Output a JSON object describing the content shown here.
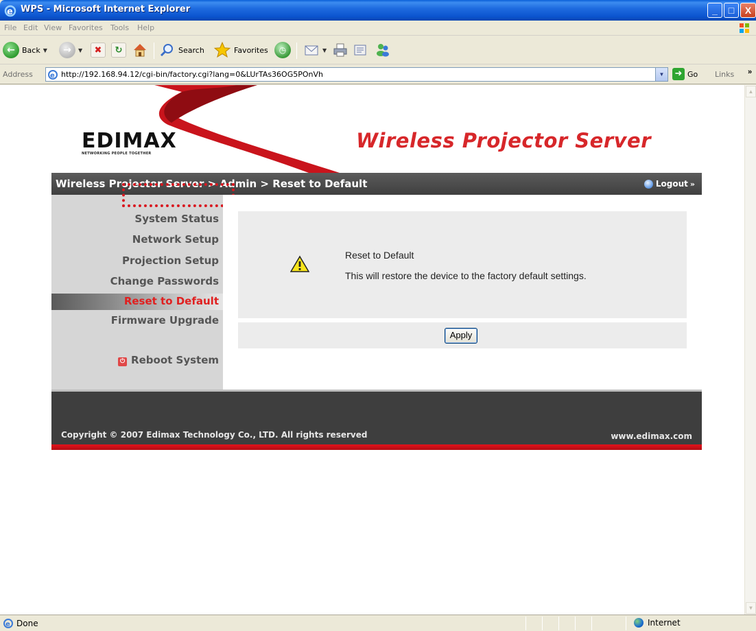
{
  "window": {
    "title": "WPS - Microsoft Internet Explorer",
    "controls": {
      "minimize": "_",
      "maximize": "□",
      "close": "X"
    }
  },
  "menu": [
    "File",
    "Edit",
    "View",
    "Favorites",
    "Tools",
    "Help"
  ],
  "toolbar": {
    "back": "Back",
    "search": "Search",
    "favorites": "Favorites"
  },
  "address": {
    "label": "Address",
    "url": "http://192.168.94.12/cgi-bin/factory.cgi?lang=0&LUrTAs36OG5POnVh",
    "go": "Go",
    "links": "Links",
    "links_more": "»"
  },
  "page": {
    "logo": "EDIMAX",
    "logo_tagline": "NETWORKING PEOPLE TOGETHER",
    "product_title": "Wireless Projector Server",
    "breadcrumb": "Wireless Projector Server > Admin > Reset to Default",
    "logout": "Logout",
    "logout_suffix": "»",
    "nav": [
      {
        "label": "System Status",
        "active": false
      },
      {
        "label": "Network Setup",
        "active": false
      },
      {
        "label": "Projection Setup",
        "active": false
      },
      {
        "label": "Change Passwords",
        "active": false
      },
      {
        "label": "Reset to Default",
        "active": true
      },
      {
        "label": "Firmware Upgrade",
        "active": false
      }
    ],
    "reboot": "Reboot System",
    "panel_title": "Reset to Default",
    "panel_text": "This will restore the device to the factory default settings.",
    "apply": "Apply",
    "copyright": "Copyright © 2007 Edimax Technology Co., LTD. All rights reserved",
    "website": "www.edimax.com"
  },
  "status": {
    "text": "Done",
    "zone": "Internet"
  },
  "colors": {
    "brand_red": "#d7272a",
    "header_dark": "#4a4a4a",
    "highlight": "#d91820"
  }
}
